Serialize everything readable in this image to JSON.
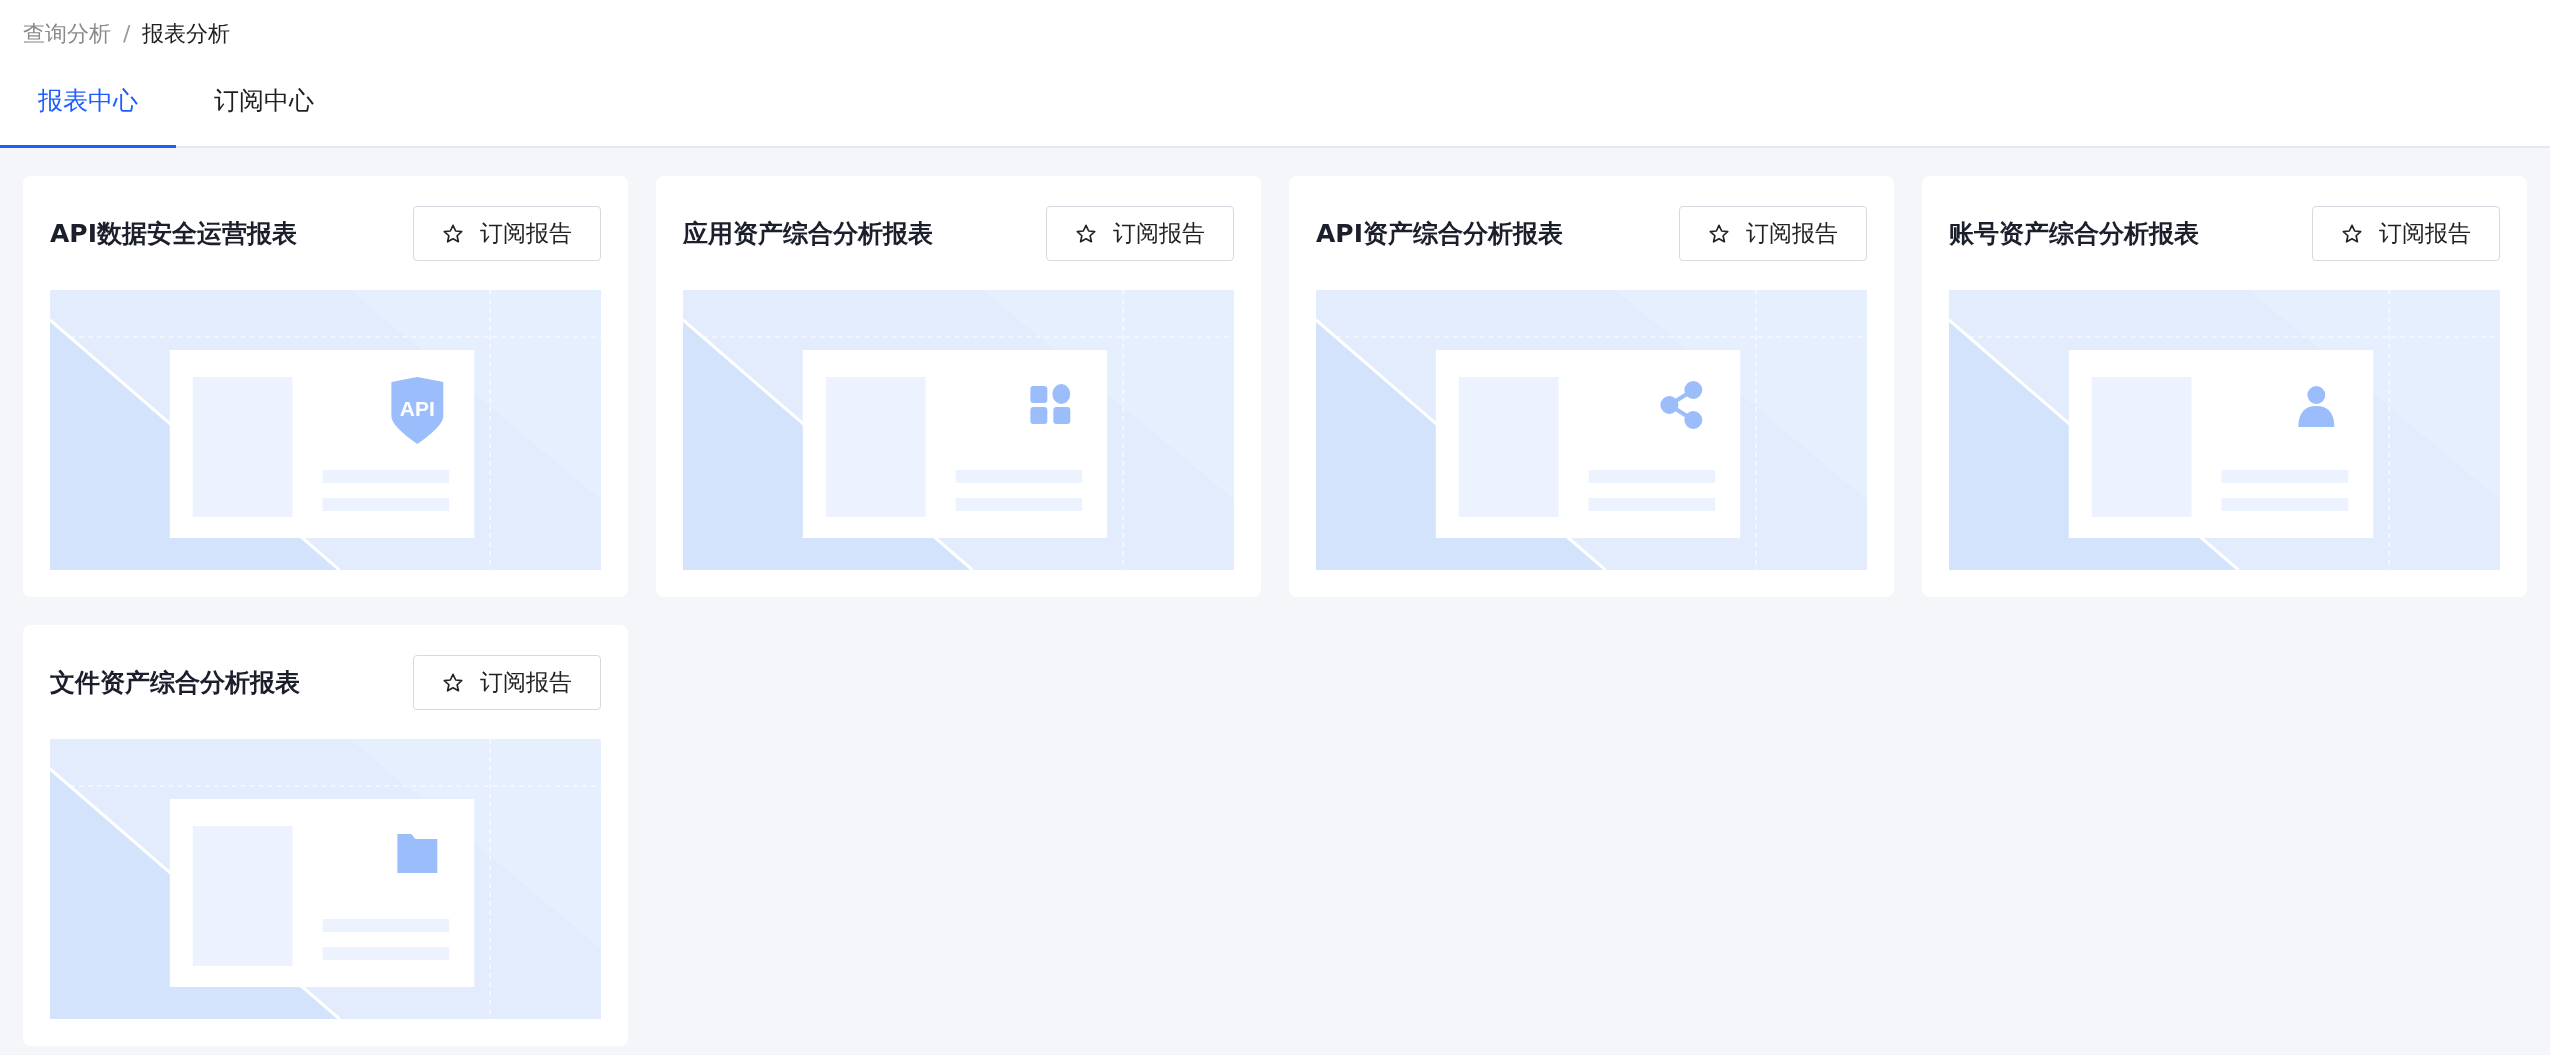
{
  "breadcrumb": [
    {
      "label": "查询分析",
      "current": false
    },
    {
      "label": "报表分析",
      "current": true
    }
  ],
  "breadcrumb_separator": "/",
  "tabs": [
    {
      "label": "报表中心",
      "selected": true
    },
    {
      "label": "订阅中心",
      "selected": false
    }
  ],
  "reports": [
    {
      "title": "API数据安全运营报表",
      "button": "订阅报告",
      "kind": "shield",
      "icon_label": "API"
    },
    {
      "title": "应用资产综合分析报表",
      "button": "订阅报告",
      "kind": "apps"
    },
    {
      "title": "API资产综合分析报表",
      "button": "订阅报告",
      "kind": "share"
    },
    {
      "title": "账号资产综合分析报表",
      "button": "订阅报告",
      "kind": "person"
    },
    {
      "title": "文件资产综合分析报表",
      "button": "订阅报告",
      "kind": "folder"
    }
  ]
}
